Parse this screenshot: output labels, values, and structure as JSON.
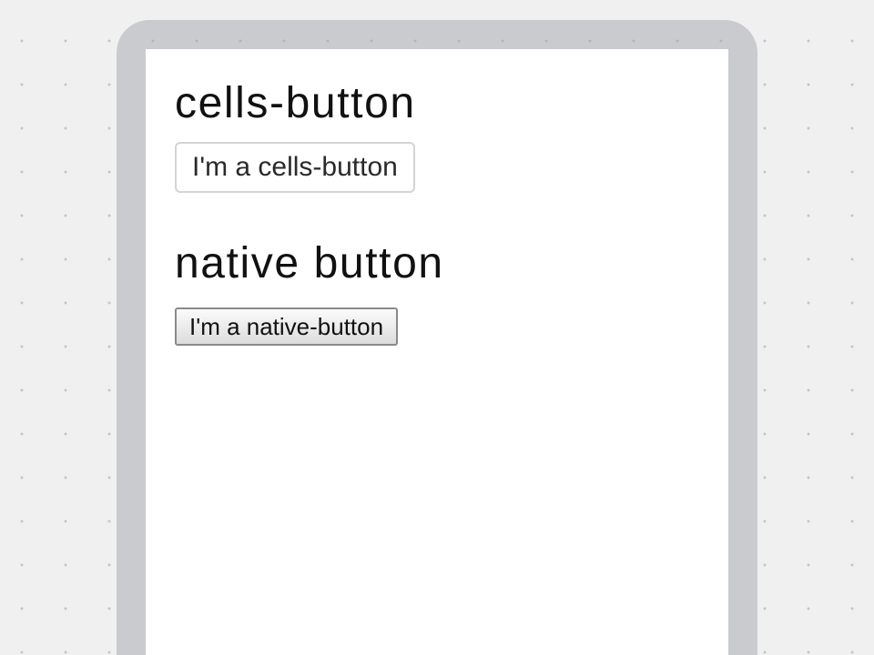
{
  "sections": [
    {
      "heading": "cells-button",
      "button_label": "I'm a cells-button"
    },
    {
      "heading": "native button",
      "button_label": "I'm a native-button"
    }
  ],
  "colors": {
    "page_background": "#f0f0f0",
    "device_frame": "#cacbcf",
    "screen_background": "#ffffff",
    "cells_button_border": "#d4d4d4",
    "native_button_border": "#8a8a8a"
  }
}
